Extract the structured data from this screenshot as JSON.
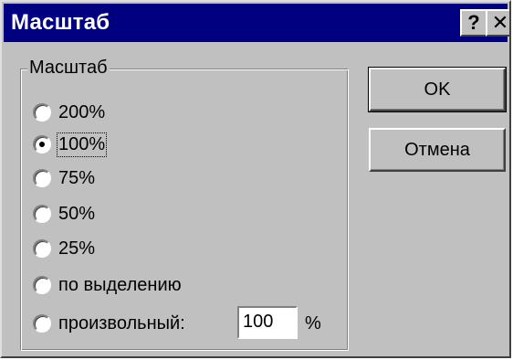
{
  "window": {
    "title": "Масштаб",
    "help_button": "?",
    "close_button": "✕"
  },
  "group": {
    "label": "Масштаб",
    "options": [
      {
        "label": "200%",
        "selected": false
      },
      {
        "label": "100%",
        "selected": true
      },
      {
        "label": "75%",
        "selected": false
      },
      {
        "label": "50%",
        "selected": false
      },
      {
        "label": "25%",
        "selected": false
      },
      {
        "label": "по выделению",
        "selected": false
      },
      {
        "label": "произвольный:",
        "selected": false
      }
    ],
    "custom_value": "100",
    "custom_unit": "%"
  },
  "buttons": {
    "ok": "OK",
    "cancel": "Отмена"
  }
}
